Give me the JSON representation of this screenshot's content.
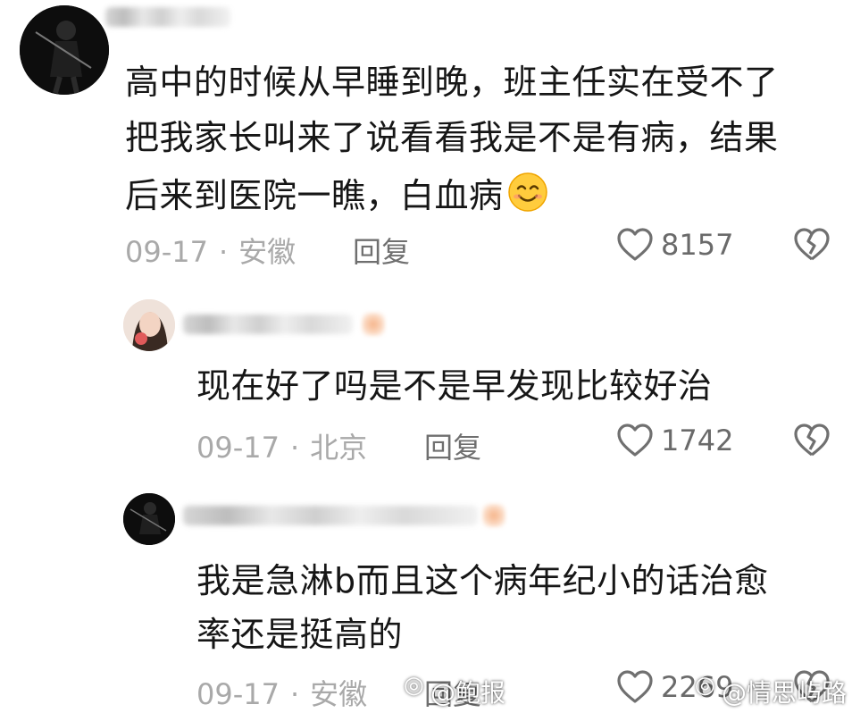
{
  "comments": [
    {
      "text_lines": [
        "高中的时候从早睡到晚，班主任实在受不了",
        "把我家长叫来了说看看我是不是有病，结果",
        "后来到医院一瞧，白血病"
      ],
      "emoji": "😊",
      "date": "09-17",
      "location": "安徽",
      "reply": "回复",
      "likes": "8157"
    },
    {
      "text_lines": [
        "现在好了吗是不是早发现比较好治"
      ],
      "date": "09-17",
      "location": "北京",
      "reply": "回复",
      "likes": "1742"
    },
    {
      "text_lines": [
        "我是急淋b而且这个病年纪小的话治愈",
        "率还是挺高的"
      ],
      "date": "09-17",
      "location": "安徽",
      "reply": "回复",
      "likes": "2269"
    }
  ],
  "separator": "·",
  "watermark": {
    "left": "@鲍报",
    "right": "@情思屿路"
  },
  "icons": {
    "like": "heart-outline-icon",
    "dislike": "broken-heart-icon"
  },
  "colors": {
    "text": "#161616",
    "meta": "#a9a9a9",
    "icon": "#707070"
  }
}
